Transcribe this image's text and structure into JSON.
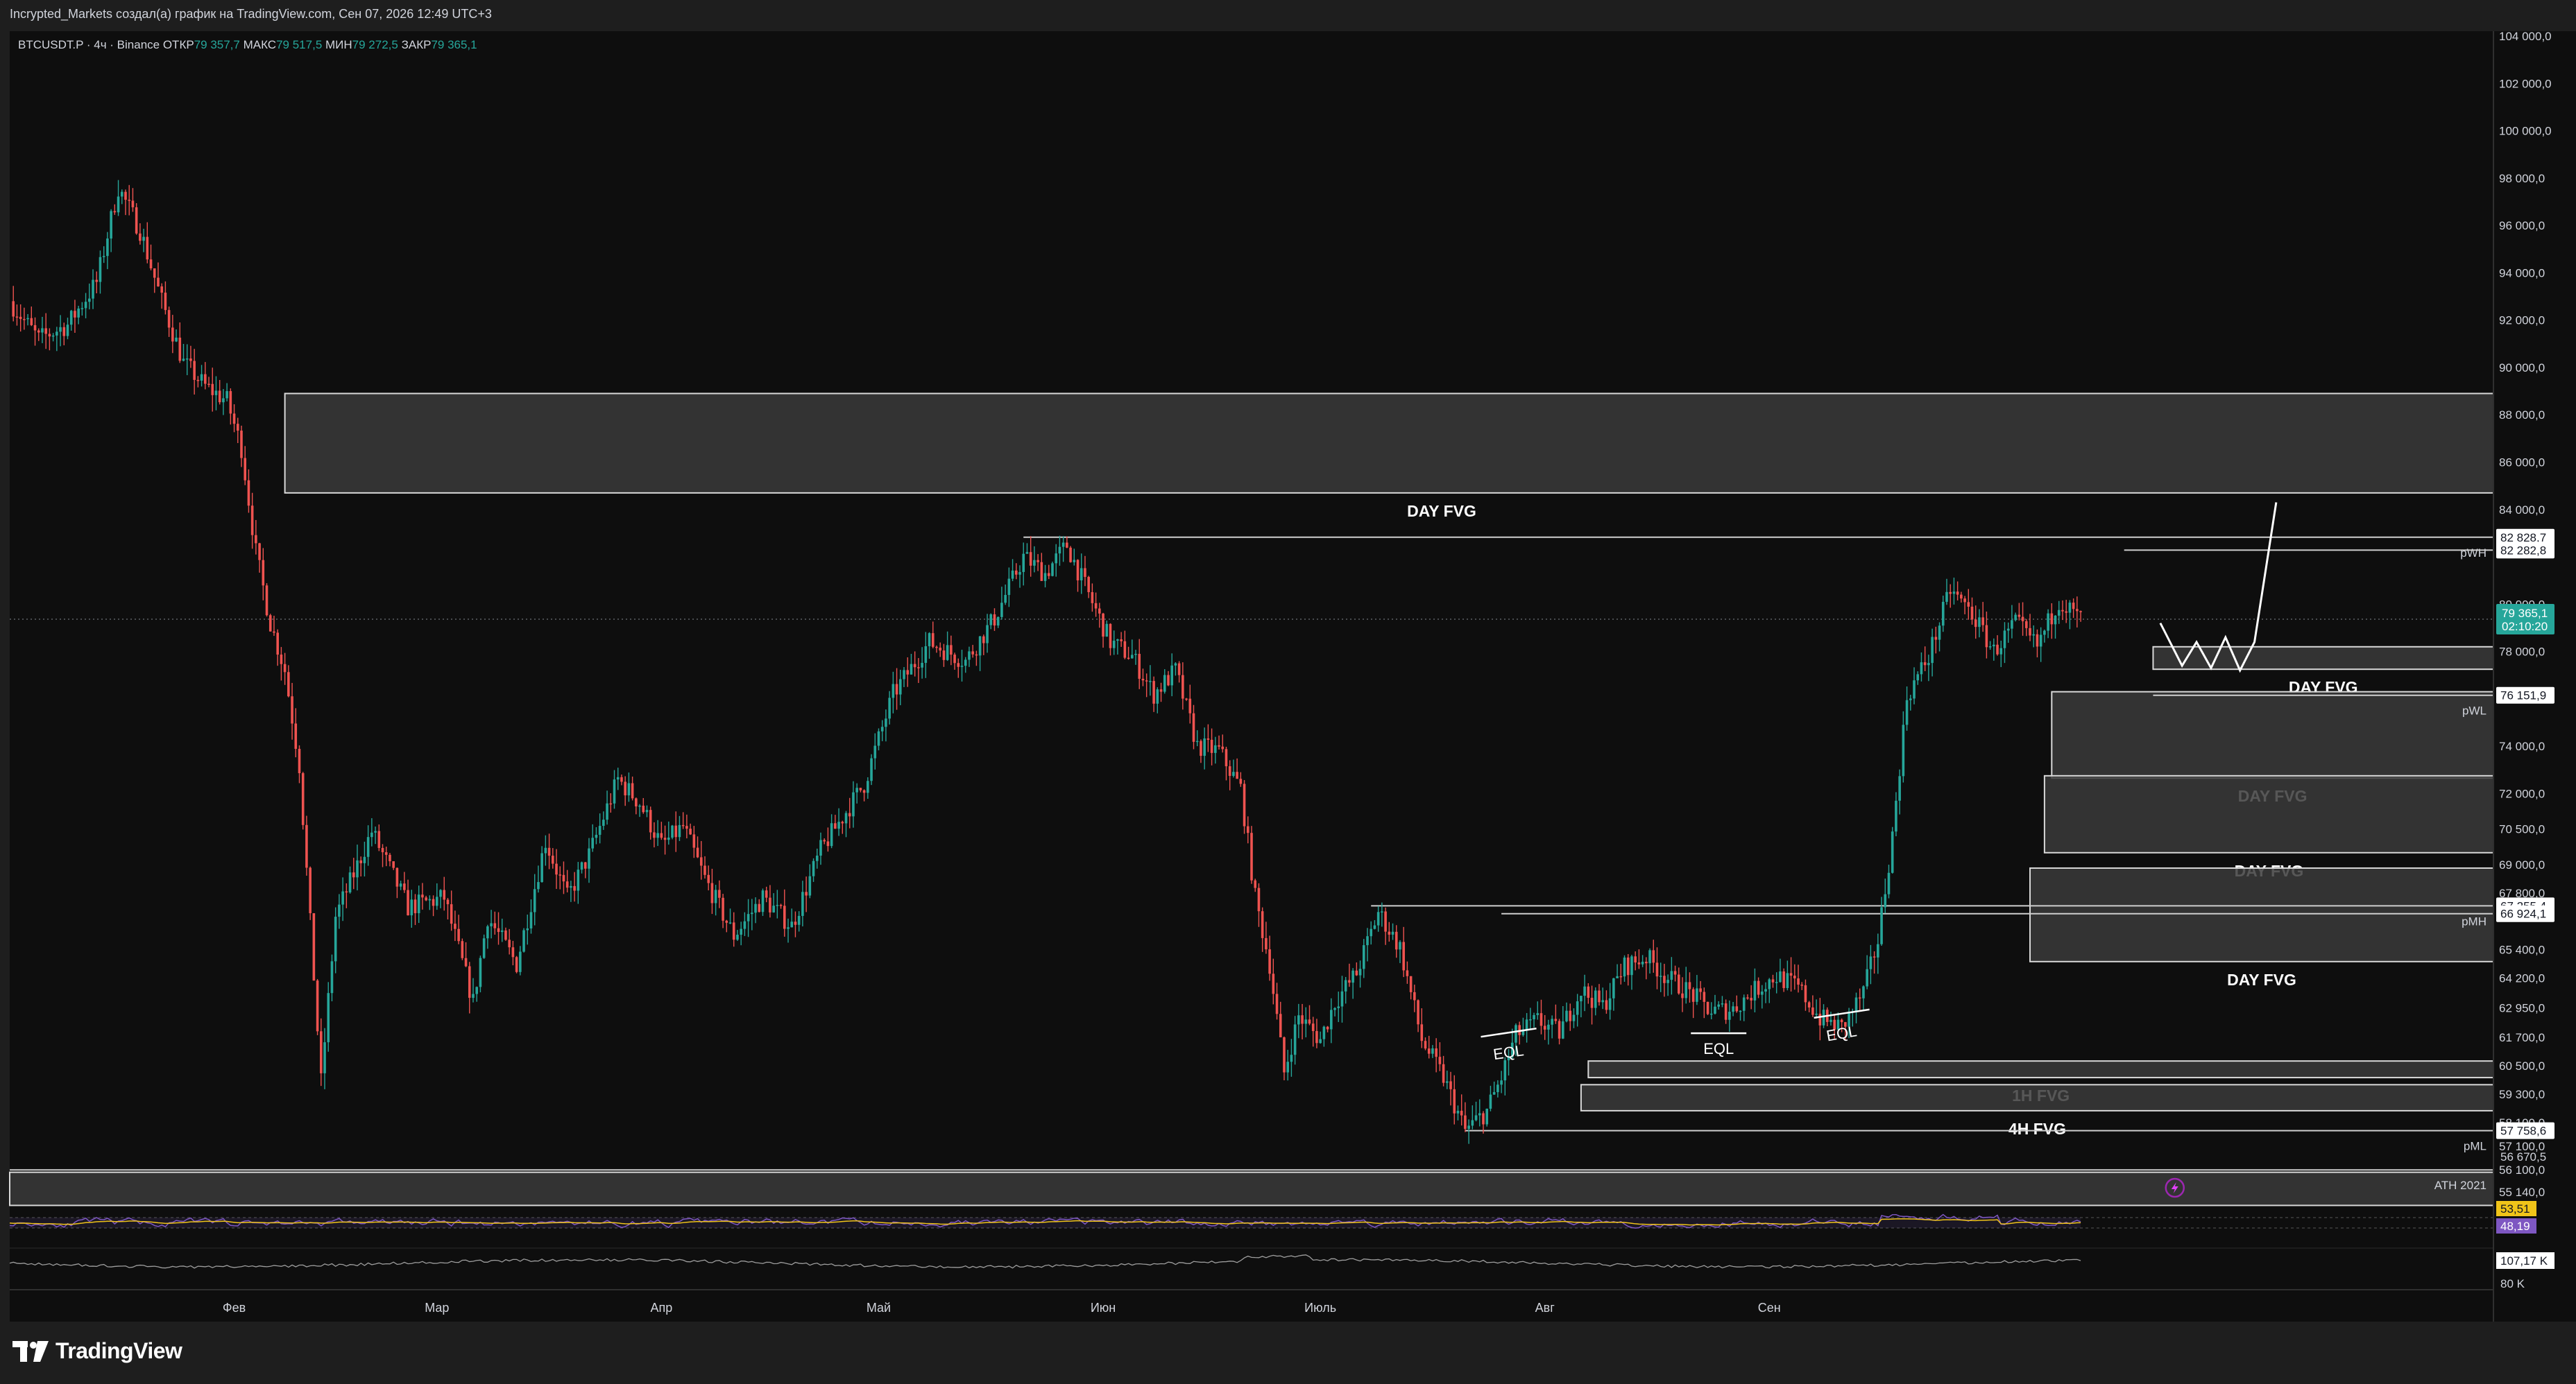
{
  "header": {
    "text": "Incrypted_Markets создал(а) график на TradingView.com, Сен 07, 2026 12:49 UTC+3"
  },
  "legend": {
    "symbol": "BTCUSDT.P · 4ч · Binance",
    "open_label": "ОТКР",
    "open_value": "79 357,7",
    "high_label": "МАКС",
    "high_value": "79 517,5",
    "low_label": "МИН",
    "low_value": "79 272,5",
    "close_label": "ЗАКР",
    "close_value": "79 365,1"
  },
  "brand": {
    "name": "TradingView"
  },
  "colors": {
    "background": "#0e0e0e",
    "up": "#26a69a",
    "down": "#ef5350",
    "zone_fill": "#3a3a3a",
    "zone_border": "#d9d9d9",
    "price_badge": "#26a69a",
    "rsi": "#7e57c2",
    "rsi_ma": "#f0c419",
    "cvd": "#9e9e9e"
  },
  "chart_data": {
    "type": "candlestick",
    "symbol": "BTCUSDT.P",
    "timeframe": "4ч",
    "exchange": "Binance",
    "x_labels": [
      "Фев",
      "Мар",
      "Апр",
      "Май",
      "Июн",
      "Июль",
      "Авг",
      "Сен"
    ],
    "x_label_days": [
      31,
      59,
      90,
      120,
      151,
      181,
      212,
      243
    ],
    "y_ticks": [
      104000,
      102000,
      100000,
      98000,
      96000,
      94000,
      92000,
      90000,
      88000,
      86000,
      84000,
      80000,
      78000,
      74000,
      72000,
      70500,
      69000,
      67800,
      65400,
      64200,
      62950,
      61700,
      60500,
      59300,
      58100,
      57100,
      56100
    ],
    "y_tick_labels": [
      "104 000,0",
      "102 000,0",
      "100 000,0",
      "98 000,0",
      "96 000,0",
      "94 000,0",
      "92 000,0",
      "90 000,0",
      "88 000,0",
      "86 000,0",
      "84 000,0",
      "80 000,0",
      "78 000,0",
      "74 000,0",
      "72 000,0",
      "70 500,0",
      "69 000,0",
      "67 800,0",
      "65 400,0",
      "64 200,0",
      "62 950,0",
      "61 700,0",
      "60 500,0",
      "59 300,0",
      "58 100,0",
      "57 100,0",
      "56 100,0"
    ],
    "y_range": [
      55140,
      104000
    ],
    "price_path": [
      [
        0,
        92800
      ],
      [
        4,
        91200
      ],
      [
        8,
        91800
      ],
      [
        12,
        93600
      ],
      [
        15,
        97600
      ],
      [
        18,
        95800
      ],
      [
        21,
        92800
      ],
      [
        24,
        90200
      ],
      [
        27,
        89200
      ],
      [
        30,
        88600
      ],
      [
        32,
        86600
      ],
      [
        34,
        82200
      ],
      [
        36,
        79200
      ],
      [
        38,
        77200
      ],
      [
        40,
        73200
      ],
      [
        43,
        59800
      ],
      [
        45,
        66800
      ],
      [
        50,
        70400
      ],
      [
        55,
        67200
      ],
      [
        60,
        67600
      ],
      [
        64,
        63200
      ],
      [
        66,
        66800
      ],
      [
        70,
        64800
      ],
      [
        74,
        70000
      ],
      [
        77,
        67600
      ],
      [
        80,
        69400
      ],
      [
        84,
        72600
      ],
      [
        87,
        71600
      ],
      [
        90,
        69800
      ],
      [
        93,
        70600
      ],
      [
        96,
        68400
      ],
      [
        100,
        66000
      ],
      [
        104,
        67600
      ],
      [
        108,
        66400
      ],
      [
        112,
        69600
      ],
      [
        118,
        72400
      ],
      [
        122,
        76200
      ],
      [
        127,
        78400
      ],
      [
        132,
        77600
      ],
      [
        136,
        79400
      ],
      [
        140,
        82000
      ],
      [
        143,
        81300
      ],
      [
        146,
        82500
      ],
      [
        149,
        80400
      ],
      [
        152,
        78400
      ],
      [
        155,
        77800
      ],
      [
        158,
        76200
      ],
      [
        161,
        77200
      ],
      [
        164,
        74000
      ],
      [
        167,
        73800
      ],
      [
        170,
        72200
      ],
      [
        172,
        67600
      ],
      [
        174,
        64800
      ],
      [
        176,
        60200
      ],
      [
        178,
        62600
      ],
      [
        181,
        61600
      ],
      [
        183,
        63200
      ],
      [
        186,
        64400
      ],
      [
        189,
        67000
      ],
      [
        192,
        65500
      ],
      [
        195,
        61600
      ],
      [
        198,
        60000
      ],
      [
        201,
        57750
      ],
      [
        204,
        58600
      ],
      [
        206,
        60000
      ],
      [
        208,
        61800
      ],
      [
        211,
        62400
      ],
      [
        214,
        61900
      ],
      [
        217,
        63700
      ],
      [
        220,
        63000
      ],
      [
        223,
        64700
      ],
      [
        226,
        65100
      ],
      [
        229,
        64200
      ],
      [
        232,
        63600
      ],
      [
        235,
        62800
      ],
      [
        238,
        62900
      ],
      [
        241,
        63700
      ],
      [
        244,
        64300
      ],
      [
        247,
        63800
      ],
      [
        250,
        62500
      ],
      [
        253,
        62100
      ],
      [
        256,
        63600
      ],
      [
        258,
        65800
      ],
      [
        260,
        70200
      ],
      [
        262,
        76100
      ],
      [
        265,
        77800
      ],
      [
        268,
        80600
      ],
      [
        271,
        79600
      ],
      [
        274,
        78000
      ],
      [
        277,
        79200
      ],
      [
        280,
        78200
      ],
      [
        283,
        80200
      ],
      [
        285,
        79600
      ],
      [
        286,
        79365
      ]
    ],
    "zones": [
      {
        "label": "DAY FVG",
        "from_day": 38,
        "top": 88900,
        "bottom": 84700
      },
      {
        "label": "DAY FVG",
        "from_day": 296,
        "top": 78200,
        "bottom": 77250
      },
      {
        "label": "DAY FVG",
        "from_day": 282,
        "top": 76300,
        "bottom": 72650
      },
      {
        "label": "DAY FVG",
        "from_day": 281,
        "top": 72750,
        "bottom": 69500
      },
      {
        "label": "DAY FVG",
        "from_day": 279,
        "top": 68850,
        "bottom": 64900
      },
      {
        "label": "1H FVG",
        "from_day": 218,
        "top": 60700,
        "bottom": 60000
      },
      {
        "label": "4H FVG",
        "from_day": 217,
        "top": 59700,
        "bottom": 58600
      },
      {
        "label": "",
        "from_day": 0,
        "top": 56000,
        "bottom": 54600
      }
    ],
    "levels": [
      {
        "label": "pWH",
        "value": 82828.7,
        "from_day": 140
      },
      {
        "label": "",
        "value": 82282.8,
        "from_day": 292
      },
      {
        "label": "pWL",
        "value": 76151.9,
        "from_day": 296
      },
      {
        "label": "pMH",
        "value": 67255.4,
        "from_day": 188
      },
      {
        "label": "",
        "value": 66924.1,
        "from_day": 206
      },
      {
        "label": "pML",
        "value": 57758.6,
        "from_day": 201
      },
      {
        "label": "ATH 2021",
        "value": 56100,
        "from_day": 0
      }
    ],
    "price_tags": [
      {
        "text": "82 828,7",
        "value": 82828.7,
        "style": "white"
      },
      {
        "text": "82 282,8",
        "value": 82282.8,
        "style": "white"
      },
      {
        "text": "76 151,9",
        "value": 76151.9,
        "style": "white"
      },
      {
        "text": "67 255,4",
        "value": 67255.4,
        "style": "white"
      },
      {
        "text": "66 924,1",
        "value": 66924.1,
        "style": "white"
      },
      {
        "text": "57 758,6",
        "value": 57758.6,
        "style": "white"
      },
      {
        "text": "56 670,5",
        "value": 56670.5,
        "style": "plain"
      }
    ],
    "current_price": {
      "value": 79365.1,
      "text": "79 365,1",
      "timer": "02:10:20"
    },
    "eql": [
      {
        "label": "EQL",
        "day": 207
      },
      {
        "label": "EQL",
        "day": 236
      },
      {
        "label": "EQL",
        "day": 253
      }
    ],
    "rsi": {
      "value": "53,51",
      "ma_value": "48,19"
    },
    "cvd": {
      "value": "107,17 K",
      "label": "80 K"
    },
    "axis_bottom_label": "55 140,0"
  }
}
